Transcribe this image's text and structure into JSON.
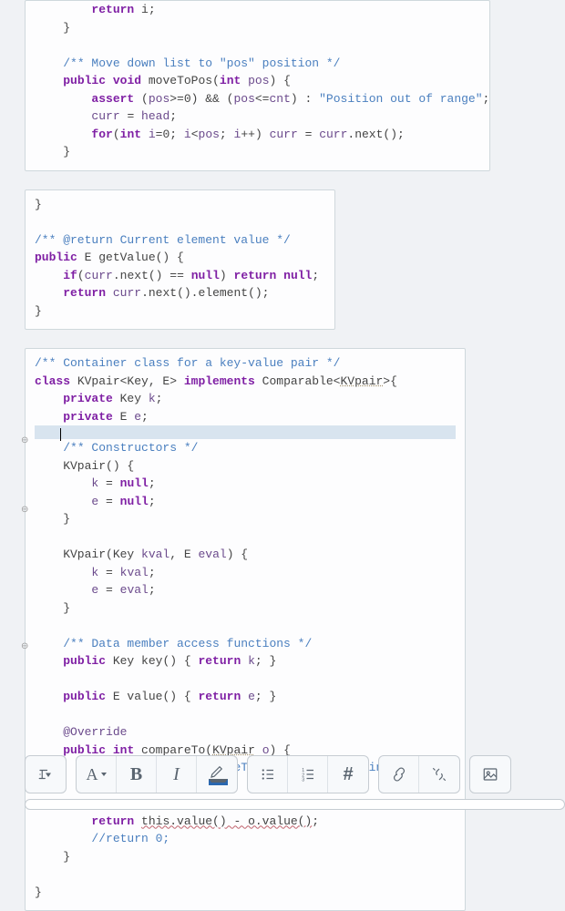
{
  "code_blocks": {
    "block1": "        return i;\n    }\n\n    /** Move down list to \"pos\" position */\n    public void moveToPos(int pos) {\n        assert (pos>=0) && (pos<=cnt) : \"Position out of range\";\n        curr = head;\n        for(int i=0; i<pos; i++) curr = curr.next();\n    }",
    "block2": "}\n\n/** @return Current element value */\npublic E getValue() {\n    if(curr.next() == null) return null;\n    return curr.next().element();\n}",
    "block3_pre": "/** Container class for a key-value pair */\nclass KVpair<Key, E> implements Comparable<KVpair>{\n    private Key k;\n    private E e;",
    "block3_post": "    /** Constructors */\n    KVpair() {\n        k = null;\n        e = null;\n    }\n\n    KVpair(Key kval, E eval) {\n        k = kval;\n        e = eval;\n    }\n\n    /** Data member access functions */\n    public Key key() { return k; }\n\n    public E value() { return e; }\n\n    @Override\n    public int compareTo(KVpair o) {\n        // define the compareTo behavior according to the\n\n\n        return this.value() - o.value();\n        //return 0;\n    }\n\n}"
  },
  "toolbar": {
    "paragraph_btn": "¶",
    "font_btn": "A",
    "bold_btn": "B",
    "italic_btn": "I",
    "hash_btn": "#"
  }
}
